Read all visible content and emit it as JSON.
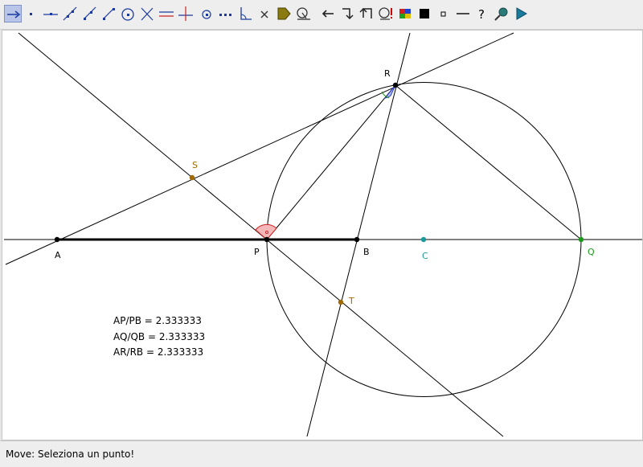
{
  "toolbar": {
    "tools": [
      {
        "name": "move-tool",
        "selected": true
      },
      {
        "name": "point-tool"
      },
      {
        "name": "point-on-object-tool"
      },
      {
        "name": "line-tool"
      },
      {
        "name": "ray-tool"
      },
      {
        "name": "segment-tool"
      },
      {
        "name": "circle-tool"
      },
      {
        "name": "intersection-tool"
      },
      {
        "name": "parallel-line-tool"
      },
      {
        "name": "perpendicular-line-tool"
      },
      {
        "name": "midpoint-tool"
      },
      {
        "name": "locus-tool"
      },
      {
        "name": "angle-tool"
      },
      {
        "name": "delete-tool"
      },
      {
        "name": "fill-tool"
      },
      {
        "name": "measure-tool"
      },
      {
        "name": "undo-tool"
      },
      {
        "name": "redo-tool"
      },
      {
        "name": "back-tool"
      },
      {
        "name": "search-tool"
      },
      {
        "name": "color-palette-tool"
      },
      {
        "name": "thick-point-tool"
      },
      {
        "name": "thin-point-tool"
      },
      {
        "name": "line-style-tool"
      },
      {
        "name": "help-tool"
      },
      {
        "name": "zoom-tool"
      },
      {
        "name": "play-tool"
      }
    ],
    "help_glyph": "?"
  },
  "points": {
    "A": "A",
    "B": "B",
    "C": "C",
    "P": "P",
    "Q": "Q",
    "R": "R",
    "S": "S",
    "T": "T"
  },
  "ratios": {
    "ap_pb": "AP/PB = 2.333333",
    "aq_qb": "AQ/QB = 2.333333",
    "ar_rb": "AR/RB = 2.333333"
  },
  "colors": {
    "point_black": "#000000",
    "point_c": "#1a9a9a",
    "point_q": "#1a9a1a",
    "point_st": "#a06a00",
    "angle_p_fill": "#f5b8b8",
    "angle_p_stroke": "#cc2222",
    "angle_r_fill": "#b8c4f0",
    "angle_r_stroke": "#2233cc"
  },
  "status": {
    "text": "Move: Seleziona un punto!"
  }
}
